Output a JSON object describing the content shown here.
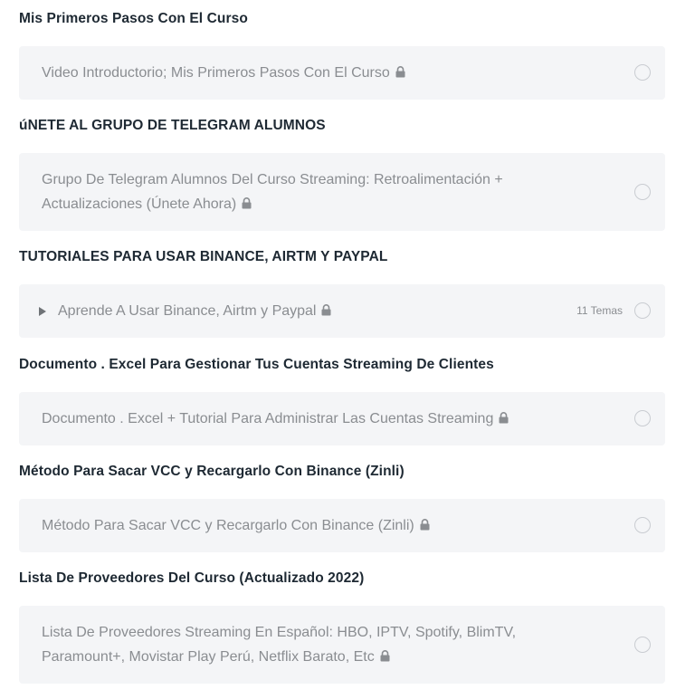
{
  "sections": [
    {
      "title": "Mis Primeros Pasos Con El Curso",
      "lesson": {
        "label": "Video Introductorio; Mis Primeros Pasos Con El Curso",
        "locked": true,
        "completed": false
      }
    },
    {
      "title": "úNETE AL GRUPO DE TELEGRAM ALUMNOS",
      "lesson": {
        "label_line1": "Grupo De Telegram Alumnos Del Curso Streaming: Retroalimentación +",
        "label_line2": "Actualizaciones (Únete Ahora)",
        "locked": true,
        "completed": false
      }
    },
    {
      "title": "TUTORIALES PARA USAR BINANCE, AIRTM Y PAYPAL",
      "lesson": {
        "label": "Aprende A Usar Binance, Airtm y Paypal",
        "topics": "11 Temas",
        "locked": true,
        "completed": false
      }
    },
    {
      "title": "Documento . Excel Para Gestionar Tus Cuentas Streaming De Clientes",
      "lesson": {
        "label": "Documento . Excel + Tutorial Para Administrar Las Cuentas Streaming",
        "locked": true,
        "completed": false
      }
    },
    {
      "title": "Método Para Sacar VCC y Recargarlo Con Binance (Zinli)",
      "lesson": {
        "label": "Método Para Sacar VCC y Recargarlo Con Binance (Zinli)",
        "locked": true,
        "completed": false
      }
    },
    {
      "title": "Lista De Proveedores Del Curso (Actualizado 2022)",
      "lesson": {
        "label_line1": "Lista De Proveedores Streaming En Español: HBO, IPTV, Spotify, BlimTV,",
        "label_line2": "Paramount+, Movistar Play Perú, Netflix Barato, Etc",
        "locked": true,
        "completed": false
      }
    }
  ],
  "icons": {
    "lock": "lock-icon",
    "status": "circle-outline-icon",
    "expand": "caret-right-icon"
  },
  "colors": {
    "section_title": "#1e2933",
    "lesson_bg": "#f4f5f7",
    "lesson_text": "#8a8d91",
    "circle_border": "#c9ccd1"
  }
}
